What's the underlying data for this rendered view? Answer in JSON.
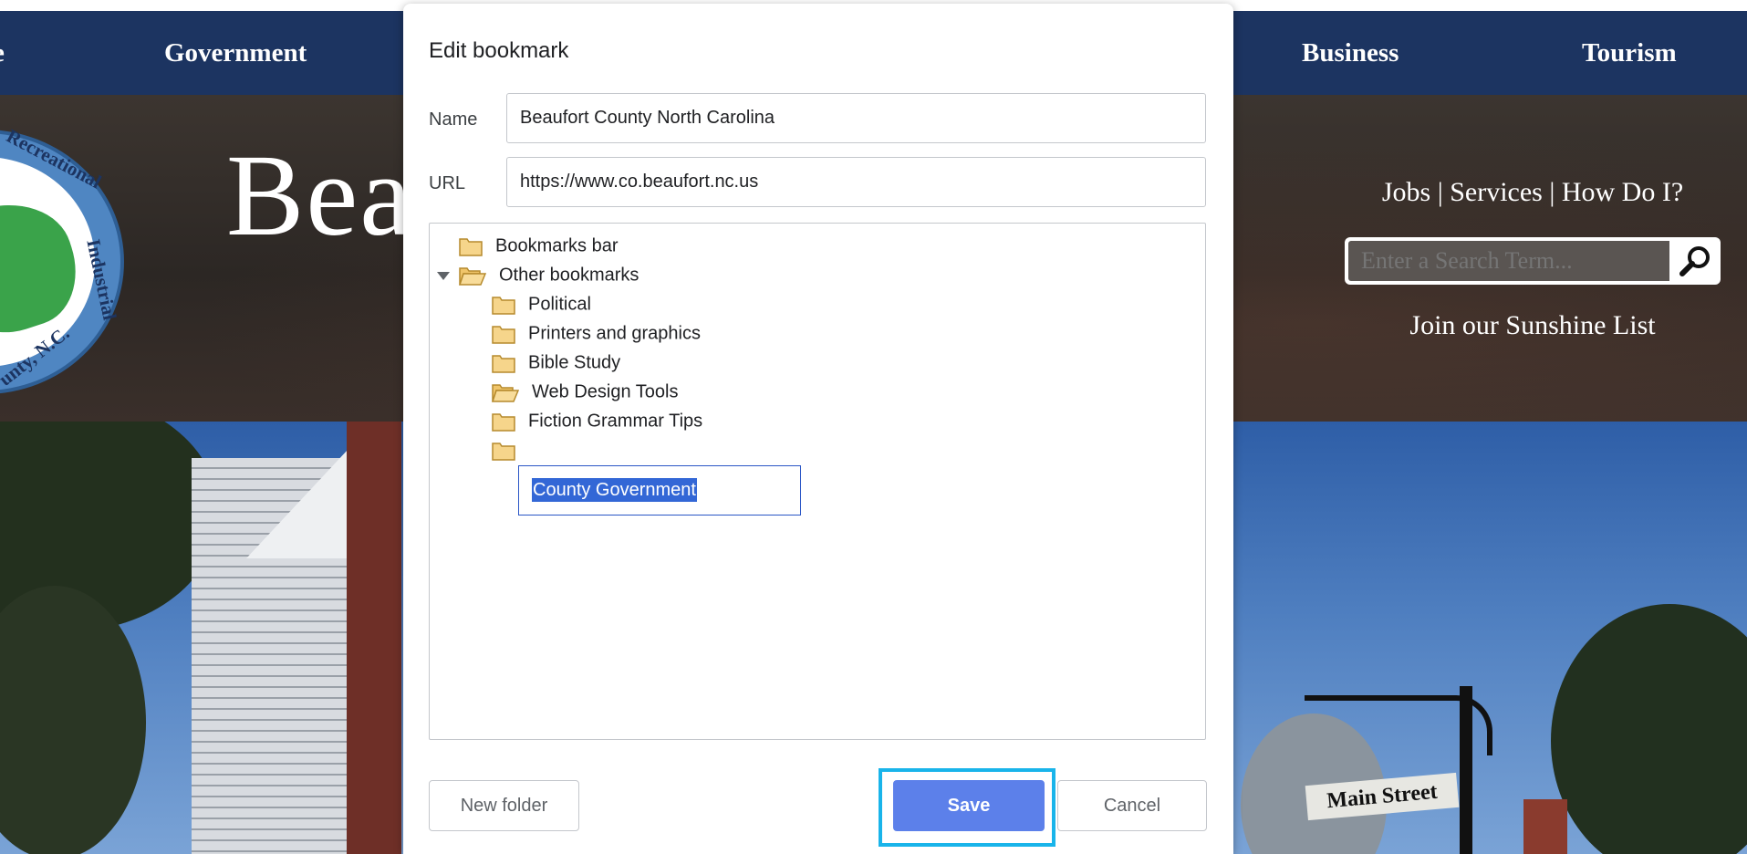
{
  "website": {
    "nav": {
      "items": [
        "e",
        "Government",
        "Business",
        "Tourism"
      ]
    },
    "title": "Bea",
    "seal_text_top": "Recreational",
    "seal_text_right": "Industrial",
    "seal_text_bottom": "unty, N.C.",
    "links": "Jobs | Services | How Do I?",
    "search": {
      "placeholder": "Enter a Search Term..."
    },
    "sunshine": "Join our Sunshine List",
    "sign_text": "Main Street"
  },
  "dialog": {
    "title": "Edit bookmark",
    "name_label": "Name",
    "name_value": "Beaufort County North Carolina",
    "url_label": "URL",
    "url_value": "https://www.co.beaufort.nc.us",
    "tree": {
      "root_items": [
        "Bookmarks bar",
        "Other bookmarks"
      ],
      "children": [
        "Political",
        "Printers and graphics",
        "Bible Study",
        "Web Design Tools",
        "Fiction Grammar Tips"
      ],
      "editing_folder": "County Government"
    },
    "buttons": {
      "new_folder": "New folder",
      "save": "Save",
      "cancel": "Cancel"
    }
  },
  "colors": {
    "nav_bg": "#1c3461",
    "primary_button": "#5c80ea",
    "focus_ring": "#19b4ea",
    "selection": "#3367d6"
  }
}
